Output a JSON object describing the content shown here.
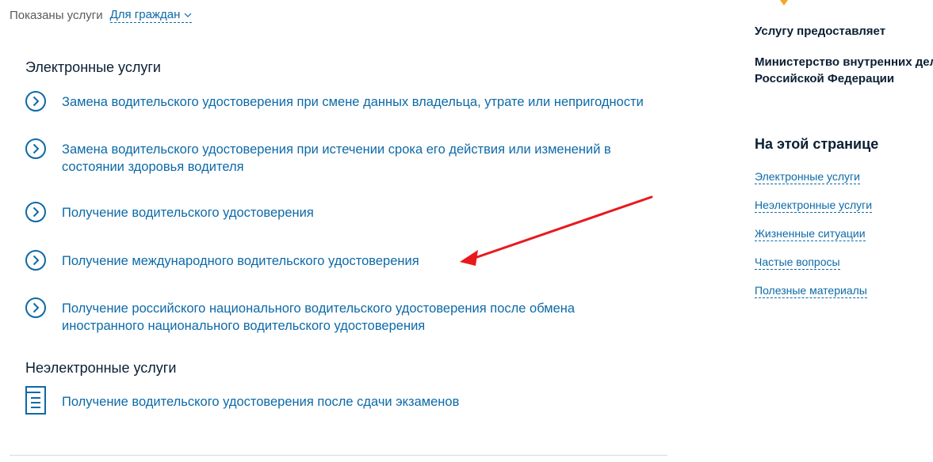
{
  "filter": {
    "label": "Показаны услуги",
    "value": "Для граждан",
    "icon": "chevron-down-icon"
  },
  "sections": {
    "electronic": {
      "title": "Электронные услуги",
      "items": [
        {
          "line1": "Замена водительского удостоверения при смене данных владельца, утрате или непригодности",
          "line2": ""
        },
        {
          "line1": "Замена водительского удостоверения при истечении срока его действия или изменений в",
          "line2": "состоянии здоровья водителя"
        },
        {
          "line1": "Получение водительского удостоверения",
          "line2": ""
        },
        {
          "line1": "Получение международного водительского удостоверения",
          "line2": ""
        },
        {
          "line1": "Получение российского национального водительского удостоверения после обмена",
          "line2": "иностранного национального водительского удостоверения"
        }
      ]
    },
    "non_electronic": {
      "title": "Неэлектронные услуги",
      "items": [
        {
          "line1": "Получение водительского удостоверения после сдачи экзаменов",
          "line2": ""
        }
      ]
    }
  },
  "provider": {
    "label": "Услугу предоставляет",
    "name_line1": "Министерство внутренних дел",
    "name_line2": "Российской Федерации"
  },
  "toc": {
    "title": "На этой странице",
    "links": [
      "Электронные услуги",
      "Неэлектронные услуги",
      "Жизненные ситуации",
      "Частые вопросы",
      "Полезные материалы"
    ]
  },
  "colors": {
    "link": "#0d6aa8",
    "text": "#0b1f33",
    "muted": "#5a5a5a",
    "arrow": "#e8191c",
    "marker": "#f5a623"
  }
}
